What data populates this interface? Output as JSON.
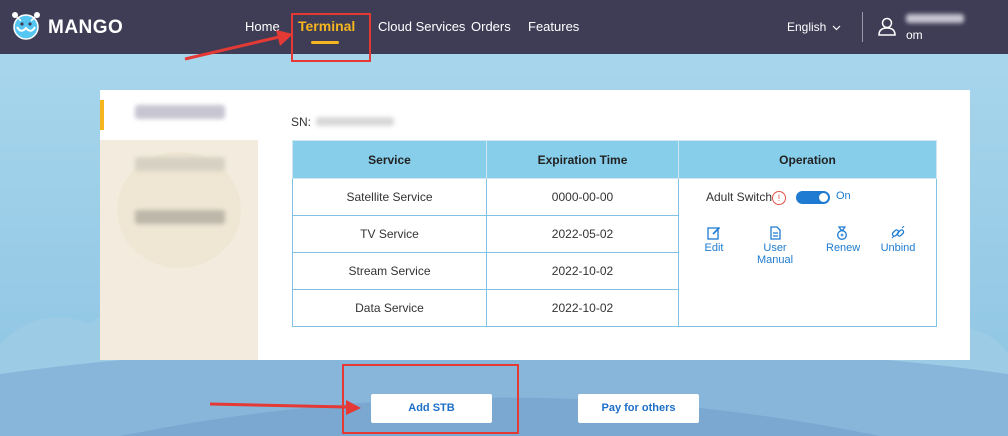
{
  "brand": {
    "name": "MANGO"
  },
  "nav": {
    "items": [
      {
        "label": "Home"
      },
      {
        "label": "Terminal"
      },
      {
        "label": "Cloud Services"
      },
      {
        "label": "Orders"
      },
      {
        "label": "Features"
      }
    ],
    "active": "Terminal",
    "language": "English"
  },
  "user": {
    "email_line2": "om"
  },
  "device": {
    "sn_label": "SN:"
  },
  "table": {
    "headers": [
      "Service",
      "Expiration Time",
      "Operation"
    ],
    "rows": [
      {
        "service": "Satellite Service",
        "expiration": "0000-00-00"
      },
      {
        "service": "TV Service",
        "expiration": "2022-05-02"
      },
      {
        "service": "Stream Service",
        "expiration": "2022-10-02"
      },
      {
        "service": "Data Service",
        "expiration": "2022-10-02"
      }
    ]
  },
  "operation": {
    "adult_switch_label": "Adult Switch",
    "adult_switch_state": "On",
    "adult_switch_on": true,
    "info_icon": "!",
    "actions": [
      {
        "label": "Edit",
        "icon": "edit-icon"
      },
      {
        "label": "User Manual",
        "icon": "manual-icon"
      },
      {
        "label": "Renew",
        "icon": "renew-icon"
      },
      {
        "label": "Unbind",
        "icon": "unbind-icon"
      }
    ]
  },
  "buttons": {
    "add_stb": "Add STB",
    "pay_for_others": "Pay for others"
  },
  "colors": {
    "header_bg": "#3f3d56",
    "active_nav": "#f5b51e",
    "accent_blue": "#1e7bd1",
    "table_header": "#87ceeb",
    "annotation_red": "#e53935"
  }
}
